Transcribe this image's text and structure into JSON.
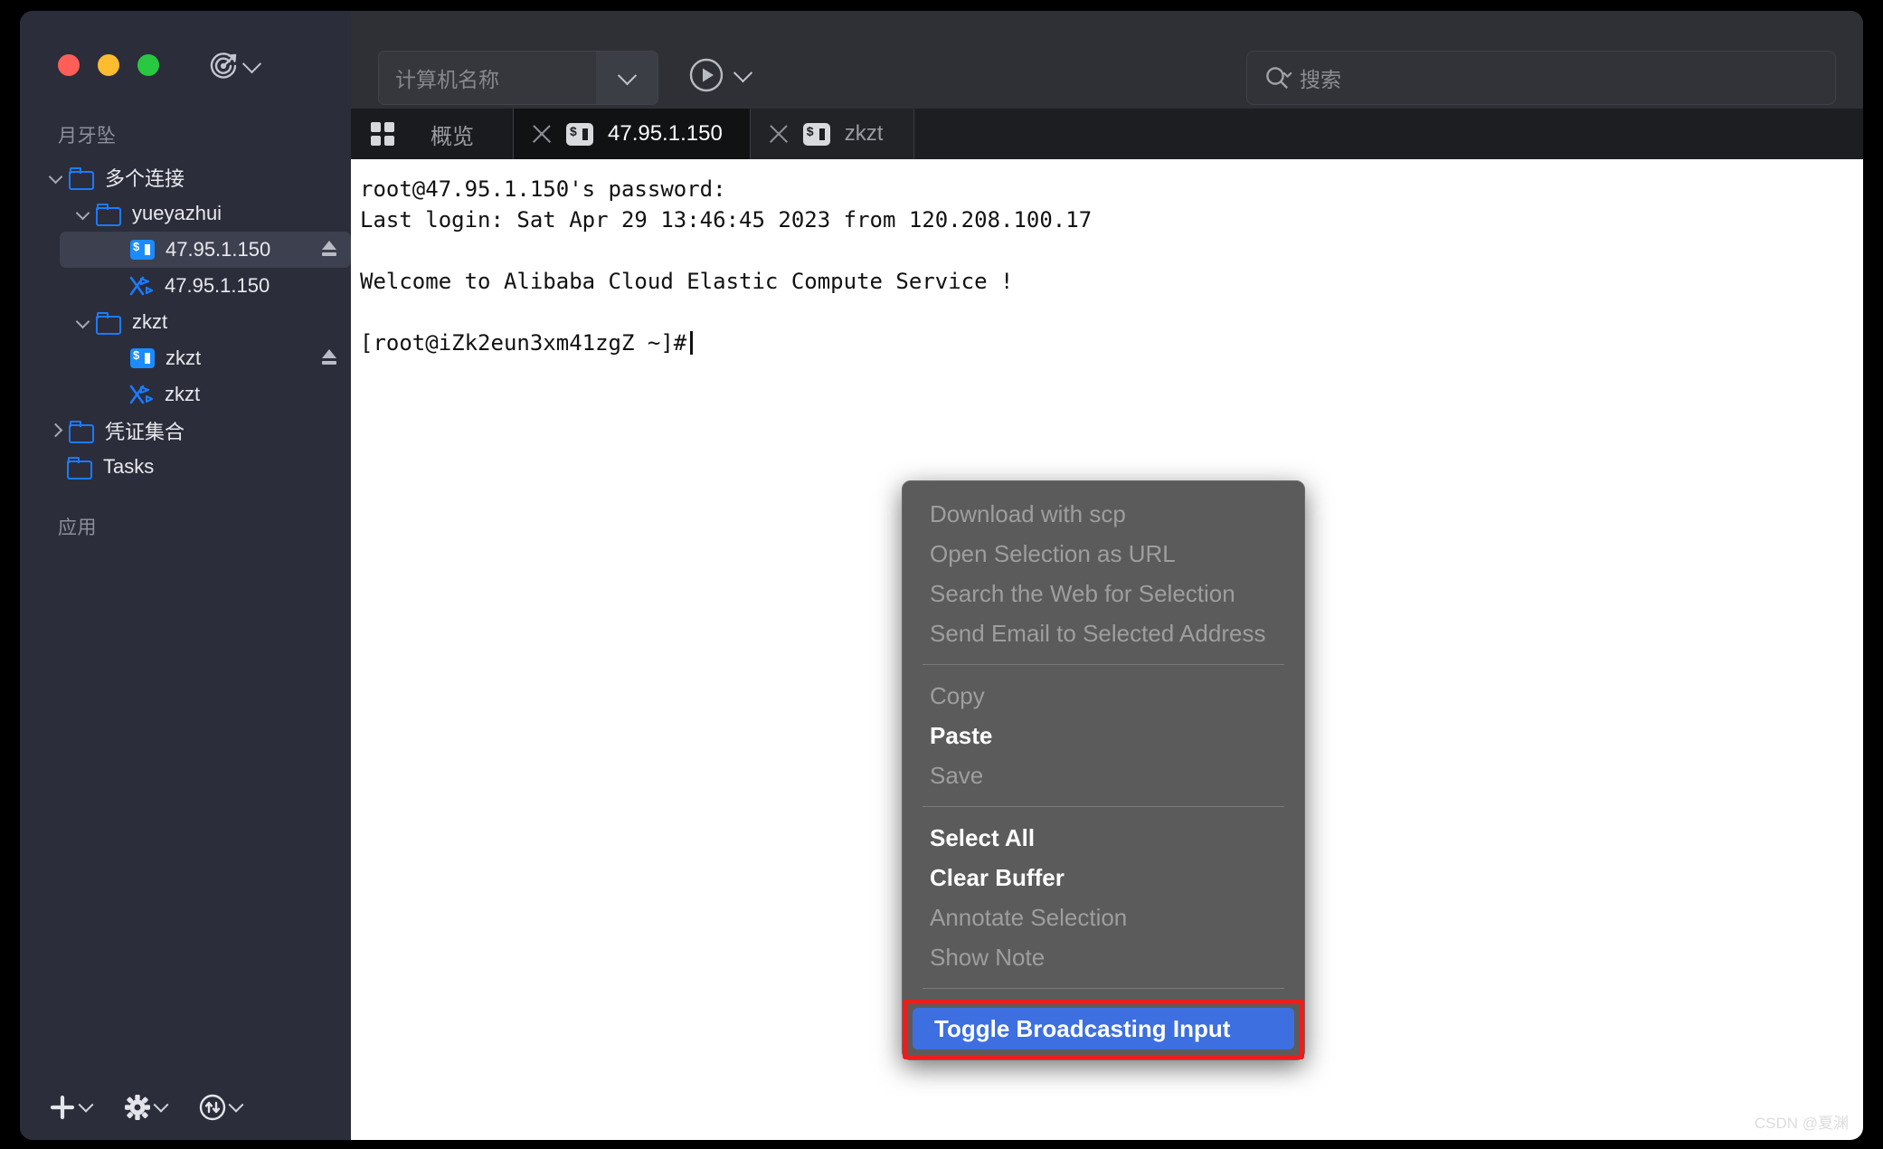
{
  "window": {
    "traffic_lights": [
      "close",
      "minimize",
      "zoom"
    ],
    "target_icon": "target-icon"
  },
  "toolbar": {
    "host_placeholder": "计算机名称",
    "host_value": "",
    "host_dropdown_icon": "chevron-down-icon",
    "run_icon": "play-circle-icon",
    "run_dropdown_icon": "chevron-down-icon",
    "search_placeholder": "搜索",
    "search_value": "",
    "search_icon": "search-icon"
  },
  "sidebar": {
    "section_hosts": "月牙坠",
    "section_apps": "应用",
    "tree": [
      {
        "label": "多个连接",
        "type": "folder",
        "depth": 0,
        "disclosure": "open",
        "selected": false,
        "eject": false
      },
      {
        "label": "yueyazhui",
        "type": "folder",
        "depth": 1,
        "disclosure": "open",
        "selected": false,
        "eject": false
      },
      {
        "label": "47.95.1.150",
        "type": "terminal",
        "depth": 2,
        "disclosure": "none",
        "selected": true,
        "eject": true
      },
      {
        "label": "47.95.1.150",
        "type": "sftp",
        "depth": 2,
        "disclosure": "none",
        "selected": false,
        "eject": false
      },
      {
        "label": "zkzt",
        "type": "folder",
        "depth": 1,
        "disclosure": "open",
        "selected": false,
        "eject": false
      },
      {
        "label": "zkzt",
        "type": "terminal",
        "depth": 2,
        "disclosure": "none",
        "selected": false,
        "eject": true
      },
      {
        "label": "zkzt",
        "type": "sftp",
        "depth": 2,
        "disclosure": "none",
        "selected": false,
        "eject": false
      },
      {
        "label": "凭证集合",
        "type": "folder",
        "depth": 0,
        "disclosure": "closed",
        "selected": false,
        "eject": false
      },
      {
        "label": "Tasks",
        "type": "folder",
        "depth": 0,
        "disclosure": "none",
        "selected": false,
        "eject": false
      }
    ],
    "bottom_buttons": [
      {
        "name": "add-button",
        "icon": "plus-icon",
        "has_dropdown": true
      },
      {
        "name": "settings-button",
        "icon": "gear-icon",
        "has_dropdown": true
      },
      {
        "name": "transfer-button",
        "icon": "transfer-icon",
        "has_dropdown": true
      },
      {
        "name": "favorites-button",
        "icon": "star-icon",
        "has_dropdown": false
      },
      {
        "name": "run-button",
        "icon": "play-icon",
        "has_dropdown": false
      }
    ]
  },
  "tabs": {
    "overview": {
      "label": "概览",
      "icon": "grid-icon",
      "active": false
    },
    "items": [
      {
        "label": "47.95.1.150",
        "icon": "terminal-icon",
        "active": true,
        "closable": true
      },
      {
        "label": "zkzt",
        "icon": "terminal-icon",
        "active": false,
        "closable": true
      }
    ]
  },
  "terminal": {
    "lines": [
      "root@47.95.1.150's password:",
      "Last login: Sat Apr 29 13:46:45 2023 from 120.208.100.17",
      "",
      "Welcome to Alibaba Cloud Elastic Compute Service !",
      "",
      "[root@iZk2eun3xm41zgZ ~]#"
    ],
    "prompt": "[root@iZk2eun3xm41zgZ ~]#",
    "cursor_visible": true
  },
  "context_menu": {
    "groups": [
      [
        {
          "label": "Download with scp",
          "enabled": false
        },
        {
          "label": "Open Selection as URL",
          "enabled": false
        },
        {
          "label": "Search the Web for Selection",
          "enabled": false
        },
        {
          "label": "Send Email to Selected Address",
          "enabled": false
        }
      ],
      [
        {
          "label": "Copy",
          "enabled": false
        },
        {
          "label": "Paste",
          "enabled": true
        },
        {
          "label": "Save",
          "enabled": false
        }
      ],
      [
        {
          "label": "Select All",
          "enabled": true
        },
        {
          "label": "Clear Buffer",
          "enabled": true
        },
        {
          "label": "Annotate Selection",
          "enabled": false
        },
        {
          "label": "Show Note",
          "enabled": false
        }
      ]
    ],
    "highlighted_item": {
      "label": "Toggle Broadcasting Input",
      "enabled": true
    }
  },
  "annotation": {
    "box_color": "#ef1c1c",
    "highlight_color": "#3d6fe0"
  },
  "watermark": "CSDN @夏渊",
  "colors": {
    "accent_blue": "#1a8cff",
    "selection_blue": "#3d6fe0",
    "sidebar_bg": "#2b2d3a",
    "toolbar_bg": "#2e3036",
    "tabbar_bg": "#1d1e21",
    "terminal_bg": "#ffffff",
    "menu_bg": "#5b5b5b"
  }
}
